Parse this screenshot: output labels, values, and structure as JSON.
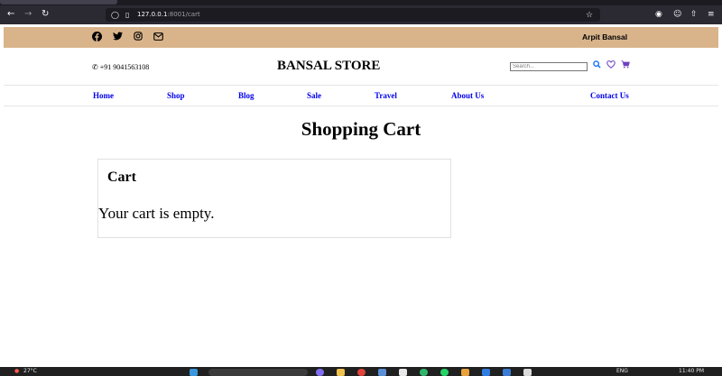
{
  "browser": {
    "url_host": "127.0.0.1",
    "url_rest": ":8001/cart"
  },
  "topbar": {
    "social_icons": [
      "facebook-icon",
      "twitter-icon",
      "instagram-icon",
      "mail-icon"
    ],
    "user_name": "Arpit Bansal"
  },
  "header": {
    "phone": "+91 9041563108",
    "brand": "BANSAL STORE",
    "search_placeholder": "Search...",
    "icons": [
      "search-icon",
      "heart-icon",
      "cart-icon"
    ]
  },
  "nav": {
    "items": [
      {
        "label": "Home"
      },
      {
        "label": "Shop"
      },
      {
        "label": "Blog"
      },
      {
        "label": "Sale"
      },
      {
        "label": "Travel"
      },
      {
        "label": "About Us"
      },
      {
        "label": "Contact Us"
      }
    ]
  },
  "main": {
    "title": "Shopping Cart",
    "cart": {
      "heading": "Cart",
      "empty_message": "Your cart is empty."
    }
  },
  "taskbar": {
    "weather": "27°C",
    "language": "ENG",
    "time": "11:40 PM"
  },
  "colors": {
    "topbar_bg": "#d9b48b",
    "nav_link": "#0000ee",
    "header_icon": "#0d6efd",
    "heart_icon": "#6f42c1",
    "cart_icon": "#6f42c1"
  }
}
